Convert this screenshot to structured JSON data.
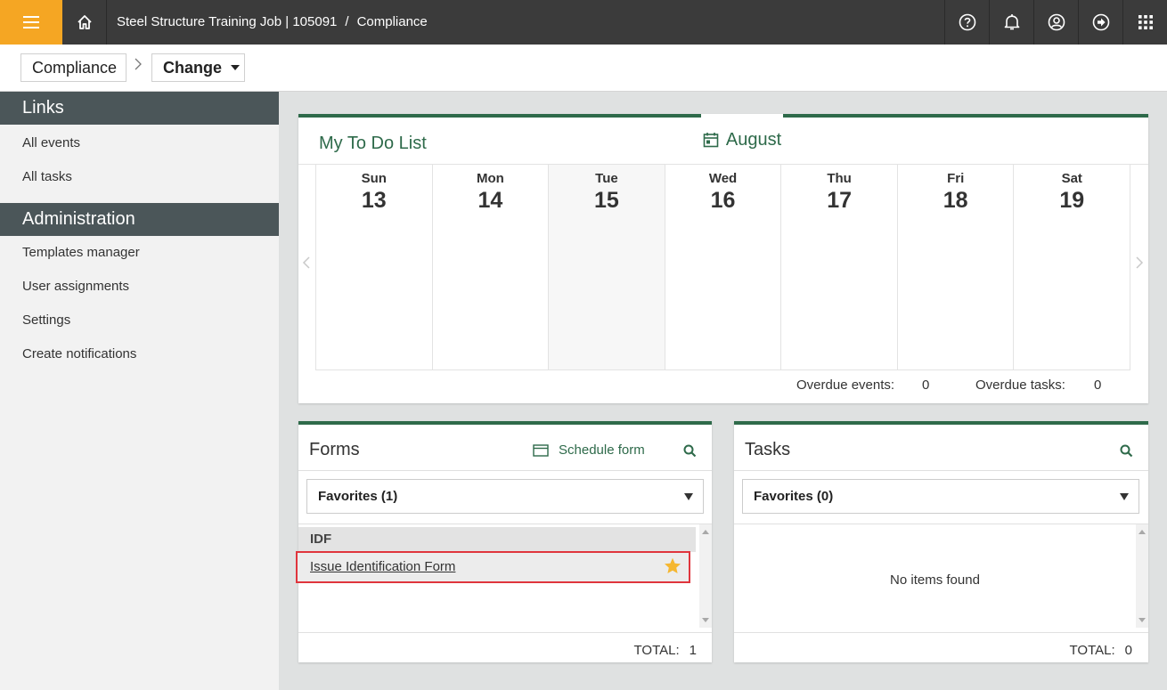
{
  "topbar": {
    "menu_icon": "hamburger-icon",
    "home_icon": "home-icon",
    "job_title": "Steel Structure Training Job | 105091",
    "separator": "/",
    "section": "Compliance",
    "icons": [
      "help-icon",
      "bell-icon",
      "user-icon",
      "logout-icon",
      "apps-grid-icon"
    ],
    "menu_color": "#f5a623",
    "bar_color": "#3b3b3b"
  },
  "breadcrumb": {
    "root": "Compliance",
    "current": "Change"
  },
  "sidebar": {
    "links_header": "Links",
    "links": [
      "All events",
      "All tasks"
    ],
    "admin_header": "Administration",
    "admin_items": [
      "Templates manager",
      "User assignments",
      "Settings",
      "Create notifications"
    ]
  },
  "todo": {
    "title": "My To Do List",
    "month": "August",
    "days": [
      {
        "name": "Sun",
        "num": "13"
      },
      {
        "name": "Mon",
        "num": "14"
      },
      {
        "name": "Tue",
        "num": "15"
      },
      {
        "name": "Wed",
        "num": "16"
      },
      {
        "name": "Thu",
        "num": "17"
      },
      {
        "name": "Fri",
        "num": "18"
      },
      {
        "name": "Sat",
        "num": "19"
      }
    ],
    "today_index": 2,
    "overdue_events_label": "Overdue events:",
    "overdue_events_value": "0",
    "overdue_tasks_label": "Overdue tasks:",
    "overdue_tasks_value": "0",
    "accent_color": "#2e6a4a"
  },
  "forms": {
    "title": "Forms",
    "schedule_label": "Schedule form",
    "filter": "Favorites (1)",
    "group": "IDF",
    "item": "Issue Identification Form",
    "total_label": "TOTAL:",
    "total_value": "1",
    "highlight_color": "#e0353d",
    "star_color": "#f5b731"
  },
  "tasks": {
    "title": "Tasks",
    "filter": "Favorites (0)",
    "empty": "No items found",
    "total_label": "TOTAL:",
    "total_value": "0"
  }
}
